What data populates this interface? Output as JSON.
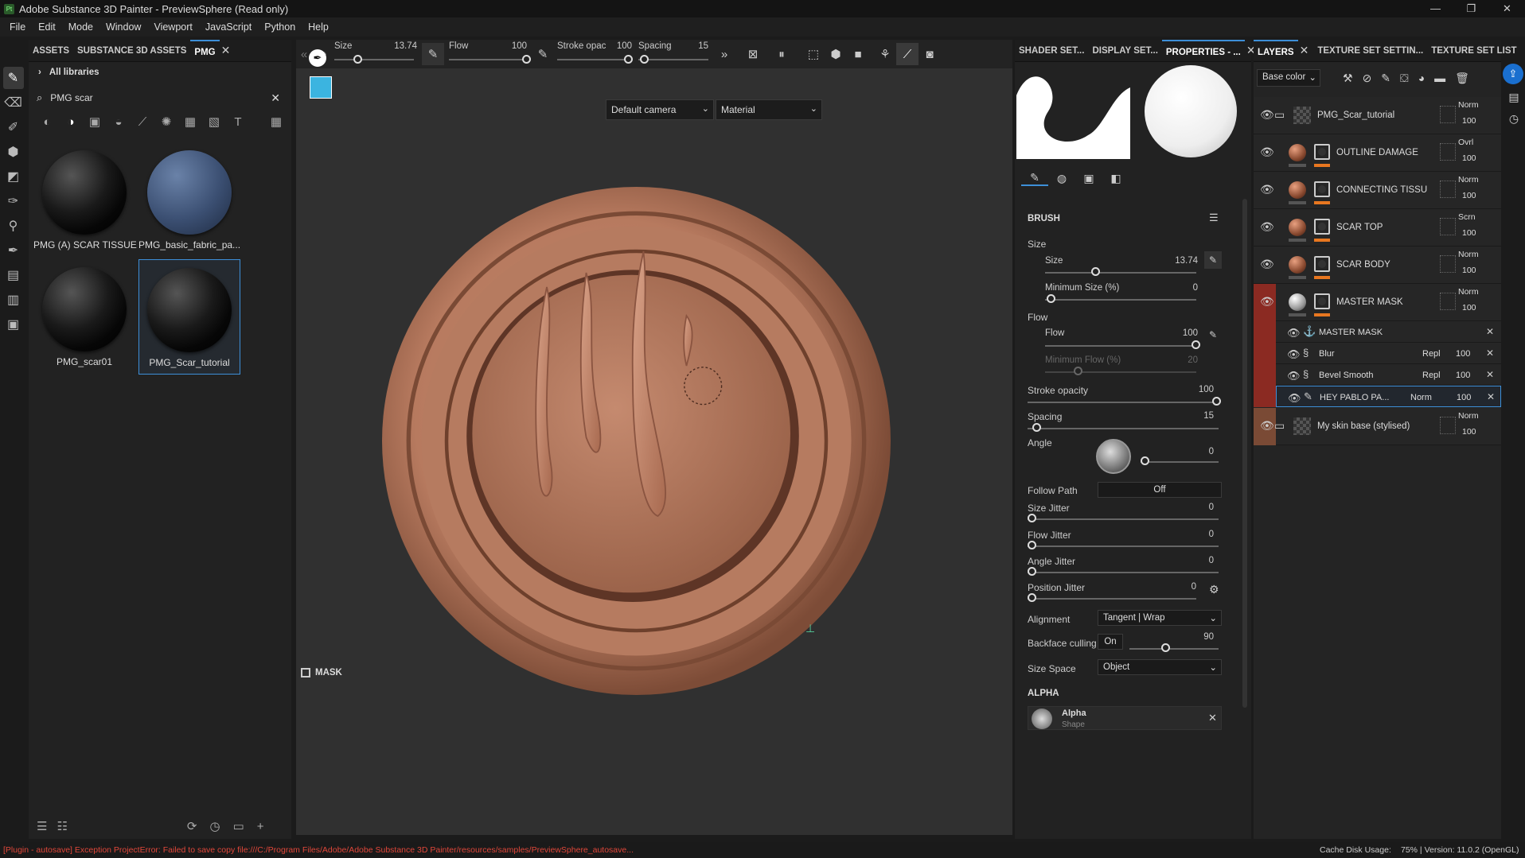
{
  "titlebar": {
    "title": "Adobe Substance 3D Painter - PreviewSphere (Read only)",
    "app_icon": "Pt"
  },
  "menu": [
    "File",
    "Edit",
    "Mode",
    "Window",
    "Viewport",
    "JavaScript",
    "Python",
    "Help"
  ],
  "assets_panel": {
    "tabs": [
      "ASSETS",
      "SUBSTANCE 3D ASSETS",
      "PMG"
    ],
    "library": "All libraries",
    "search_value": "PMG scar",
    "items": [
      {
        "label": "PMG (A) SCAR TISSUE"
      },
      {
        "label": "PMG_basic_fabric_pa..."
      },
      {
        "label": "PMG_scar01"
      },
      {
        "label": "PMG_Scar_tutorial"
      }
    ]
  },
  "viewport_toolbar": {
    "size_label": "Size",
    "size_value": "13.74",
    "flow_label": "Flow",
    "flow_value": "100",
    "stroke_label": "Stroke opac",
    "stroke_value": "100",
    "spacing_label": "Spacing",
    "spacing_value": "15"
  },
  "viewport": {
    "camera": "Default camera",
    "mode": "Material",
    "mask_label": "MASK"
  },
  "properties_panel": {
    "tabs": [
      "SHADER SET...",
      "DISPLAY SET...",
      "PROPERTIES - ..."
    ],
    "section": "BRUSH",
    "size_group": "Size",
    "size_label": "Size",
    "size_value": "13.74",
    "min_size_label": "Minimum Size (%)",
    "min_size_value": "0",
    "flow_group": "Flow",
    "flow_label": "Flow",
    "flow_value": "100",
    "min_flow_label": "Minimum Flow (%)",
    "min_flow_value": "20",
    "stroke_opacity_label": "Stroke opacity",
    "stroke_opacity_value": "100",
    "spacing_label": "Spacing",
    "spacing_value": "15",
    "angle_label": "Angle",
    "angle_value": "0",
    "follow_path_label": "Follow Path",
    "follow_path_value": "Off",
    "size_jitter_label": "Size Jitter",
    "size_jitter_value": "0",
    "flow_jitter_label": "Flow Jitter",
    "flow_jitter_value": "0",
    "angle_jitter_label": "Angle Jitter",
    "angle_jitter_value": "0",
    "position_jitter_label": "Position Jitter",
    "position_jitter_value": "0",
    "alignment_label": "Alignment",
    "alignment_value": "Tangent | Wrap",
    "backface_label": "Backface culling",
    "backface_toggle": "On",
    "backface_value": "90",
    "size_space_label": "Size Space",
    "size_space_value": "Object",
    "alpha_section": "ALPHA",
    "alpha_name": "Alpha",
    "alpha_sub": "Shape"
  },
  "layers_panel": {
    "tabs": [
      "LAYERS",
      "TEXTURE SET SETTIN...",
      "TEXTURE SET LIST"
    ],
    "channel": "Base color",
    "layers": [
      {
        "name": "PMG_Scar_tutorial",
        "blend": "Norm",
        "opacity": "100"
      },
      {
        "name": "OUTLINE DAMAGE",
        "blend": "Ovrl",
        "opacity": "100"
      },
      {
        "name": "CONNECTING TISSU",
        "blend": "Norm",
        "opacity": "100"
      },
      {
        "name": "SCAR TOP",
        "blend": "Scrn",
        "opacity": "100"
      },
      {
        "name": "SCAR BODY",
        "blend": "Norm",
        "opacity": "100"
      },
      {
        "name": "MASTER MASK",
        "blend": "Norm",
        "opacity": "100"
      }
    ],
    "sublayers": [
      {
        "name": "MASTER MASK",
        "blend": "",
        "opacity": ""
      },
      {
        "name": "Blur",
        "blend": "Repl",
        "opacity": "100"
      },
      {
        "name": "Bevel Smooth",
        "blend": "Repl",
        "opacity": "100"
      },
      {
        "name": "HEY PABLO PA...",
        "blend": "Norm",
        "opacity": "100"
      }
    ],
    "bottom_layer": {
      "name": "My skin base (stylised)",
      "blend": "Norm",
      "opacity": "100"
    }
  },
  "status": {
    "error": "[Plugin - autosave] Exception ProjectError: Failed to save copy file:///C:/Program Files/Adobe/Adobe Substance 3D Painter/resources/samples/PreviewSphere_autosave...",
    "cache": "Cache Disk Usage:",
    "version": "75% | Version: 11.0.2 (OpenGL)"
  },
  "colors": {
    "accent": "#3d8fd8",
    "orange": "#e87720",
    "error": "#e0473a",
    "mask_red": "#8b2a22"
  }
}
